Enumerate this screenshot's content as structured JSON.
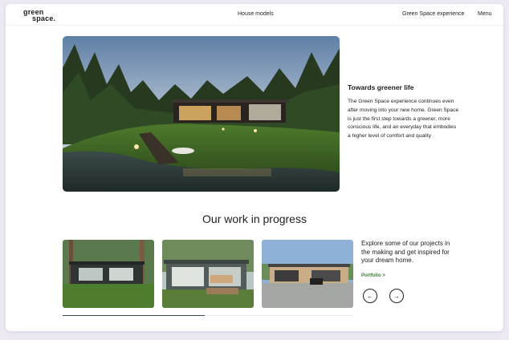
{
  "brand": {
    "logo_line1": "green",
    "logo_line2": "space."
  },
  "nav": {
    "house_models": "House models",
    "green_space_experience": "Green Space experience",
    "menu": "Menu"
  },
  "hero": {
    "image_alt": "Modern glass house by a lake at dusk",
    "title": "Towards greener life",
    "body": "The Green Space experience continues even after moving into your new home. Green Space is just the first step towards a greener, more conscious life, and an everyday that embodies a higher level of comfort and quality ."
  },
  "work": {
    "title": "Our work in progress",
    "explore_text": "Explore some of our projects in the making and get inspired for your dream home.",
    "portfolio_link": "Portfolio >",
    "prev_icon": "arrow-left-icon",
    "next_icon": "arrow-right-icon",
    "prev_glyph": "←",
    "next_glyph": "→",
    "scroll_progress": 0.49,
    "cards": [
      {
        "alt": "Dark modern house in a pine forest"
      },
      {
        "alt": "Glass house with pergola and patio"
      },
      {
        "alt": "Modern house with driveway and car"
      }
    ]
  },
  "colors": {
    "accent_green": "#3f7a3e",
    "page_bg": "#ece9f3",
    "scroll_fill": "#3e4b5c"
  }
}
